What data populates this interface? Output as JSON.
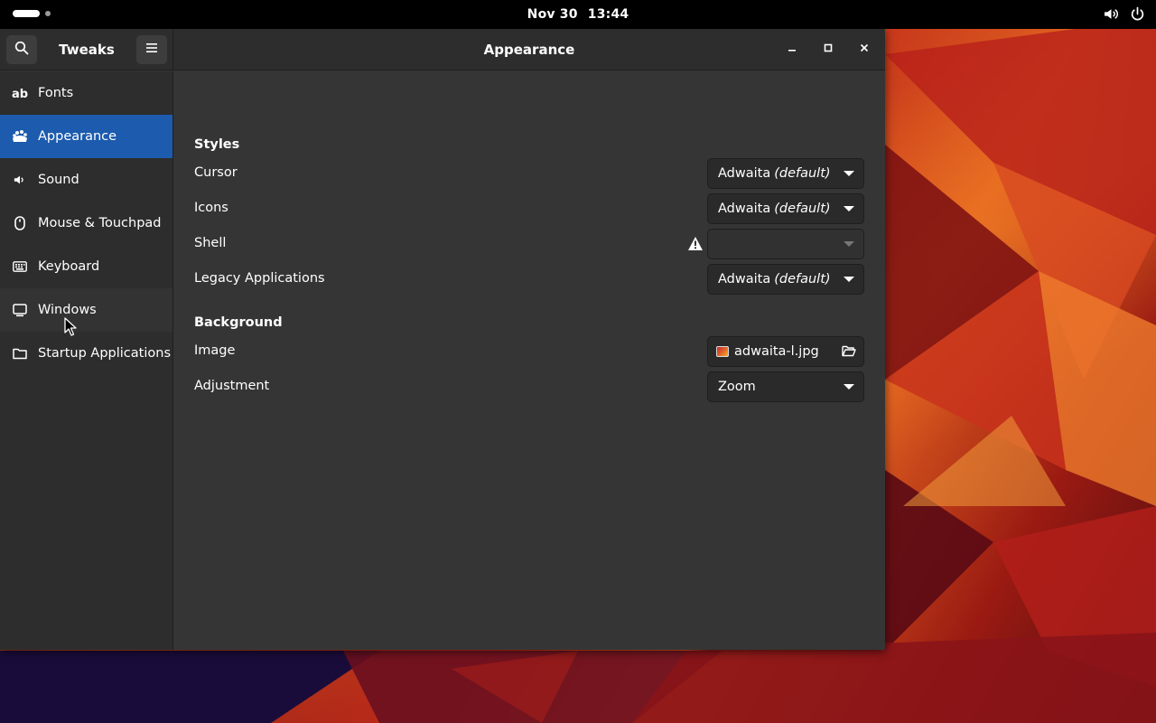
{
  "topbar": {
    "date": "Nov 30",
    "time": "13:44",
    "icons": [
      "volume-icon",
      "power-icon"
    ]
  },
  "sidebar_header": {
    "title": "Tweaks",
    "search_icon": "search-icon",
    "menu_icon": "hamburger-menu-icon"
  },
  "header": {
    "title": "Appearance",
    "controls": [
      "minimize-icon",
      "maximize-icon",
      "close-icon"
    ]
  },
  "sidebar": {
    "items": [
      {
        "label": "Fonts",
        "icon": "fonts-icon",
        "active": false
      },
      {
        "label": "Appearance",
        "icon": "appearance-icon",
        "active": true
      },
      {
        "label": "Sound",
        "icon": "sound-icon",
        "active": false
      },
      {
        "label": "Mouse & Touchpad",
        "icon": "mouse-icon",
        "active": false
      },
      {
        "label": "Keyboard",
        "icon": "keyboard-icon",
        "active": false
      },
      {
        "label": "Windows",
        "icon": "windows-icon",
        "active": false
      },
      {
        "label": "Startup Applications",
        "icon": "folder-icon",
        "active": false
      }
    ]
  },
  "styles": {
    "title": "Styles",
    "cursor": {
      "label": "Cursor",
      "value": "Adwaita",
      "suffix": "(default)"
    },
    "icons": {
      "label": "Icons",
      "value": "Adwaita",
      "suffix": "(default)"
    },
    "shell": {
      "label": "Shell",
      "value": ""
    },
    "legacy": {
      "label": "Legacy Applications",
      "value": "Adwaita",
      "suffix": "(default)"
    }
  },
  "background": {
    "title": "Background",
    "image": {
      "label": "Image",
      "value": "adwaita-l.jpg"
    },
    "adjustment": {
      "label": "Adjustment",
      "value": "Zoom"
    }
  },
  "colors": {
    "accent": "#1c5bad",
    "window_bg": "#353535",
    "header_bg": "#2d2d2d"
  }
}
